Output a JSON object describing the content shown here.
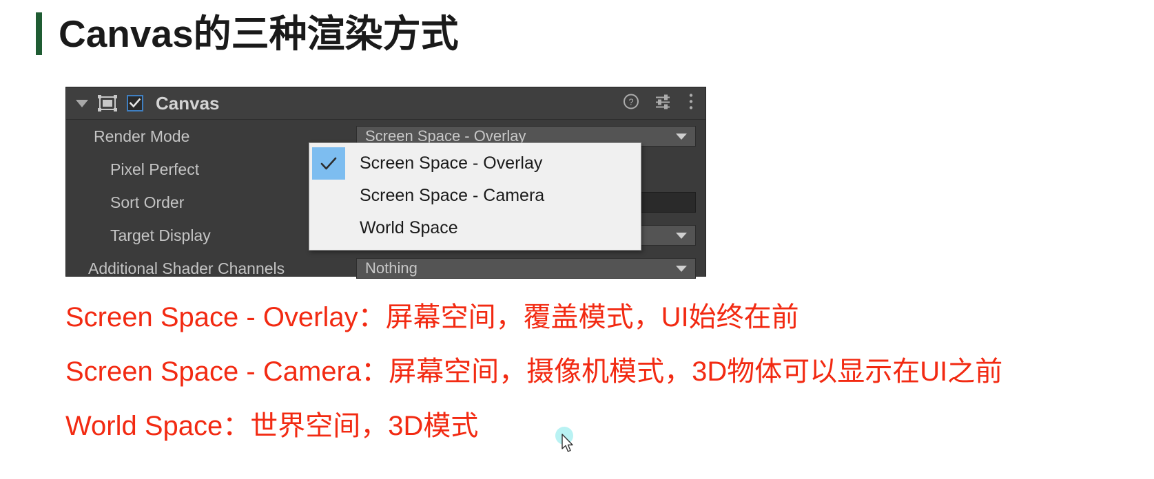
{
  "slide": {
    "title": "Canvas的三种渲染方式",
    "accent_color": "#1f5c33",
    "red_color": "#f22a12"
  },
  "inspector": {
    "component_title": "Canvas",
    "enabled": true,
    "foldout_icon": "triangle-down-icon",
    "component_icon": "canvas-icon",
    "header_icons": [
      {
        "name": "help-icon",
        "label": "?"
      },
      {
        "name": "preset-icon",
        "label": "presets"
      },
      {
        "name": "more-menu-icon",
        "label": "more"
      }
    ],
    "rows": [
      {
        "label": "Render Mode",
        "indent": false,
        "field_type": "dropdown",
        "value": "Screen Space - Overlay"
      },
      {
        "label": "Pixel Perfect",
        "indent": true,
        "field_type": "checkbox",
        "value": ""
      },
      {
        "label": "Sort Order",
        "indent": true,
        "field_type": "number",
        "value": ""
      },
      {
        "label": "Target Display",
        "indent": true,
        "field_type": "dropdown",
        "value": ""
      },
      {
        "label": "Additional Shader Channels",
        "indent": false,
        "field_type": "dropdown",
        "value": "Nothing"
      }
    ]
  },
  "dropdown": {
    "name": "render-mode-dropdown-menu",
    "selected": "Screen Space - Overlay",
    "items": [
      {
        "label": "Screen Space - Overlay",
        "checked": true
      },
      {
        "label": "Screen Space - Camera",
        "checked": false
      },
      {
        "label": "World Space",
        "checked": false
      }
    ],
    "highlight_color": "#7dbdf0"
  },
  "notes": {
    "line1": "Screen Space - Overlay：屏幕空间，覆盖模式，UI始终在前",
    "line2": "Screen Space - Camera：屏幕空间，摄像机模式，3D物体可以显示在UI之前",
    "line3": "World Space：世界空间，3D模式"
  },
  "cursor": {
    "name": "mouse-cursor",
    "click_highlight_color": "#b9f2f3"
  }
}
